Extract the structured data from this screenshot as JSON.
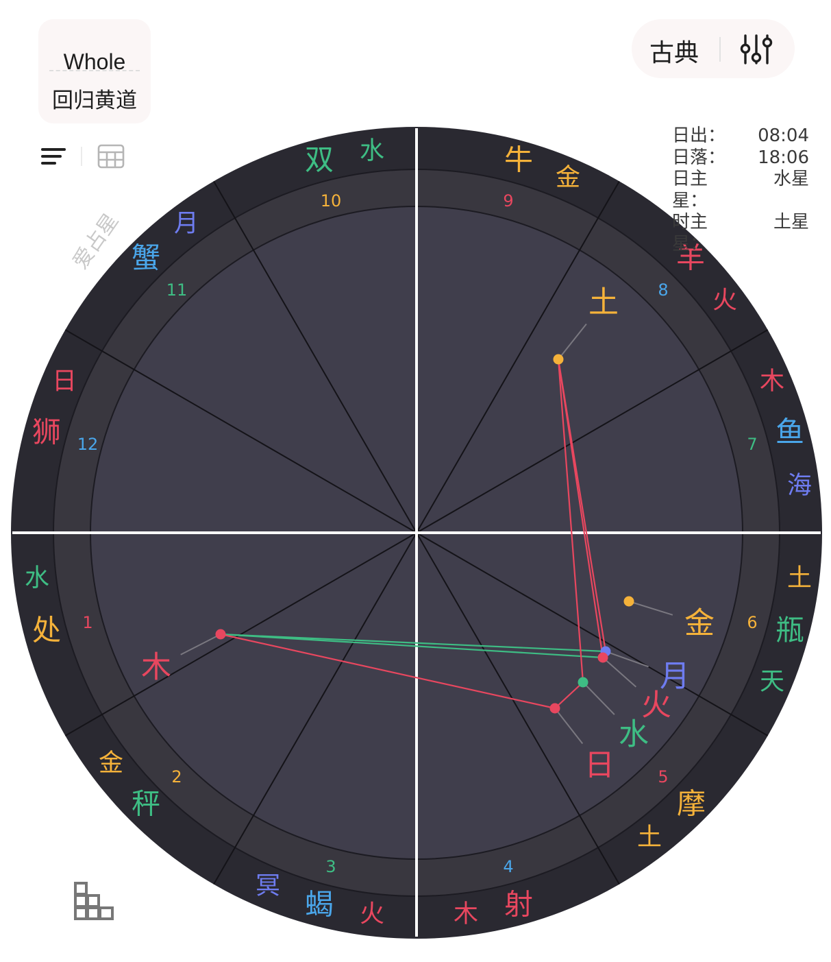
{
  "system_toggle": {
    "house_system": "Whole",
    "zodiac": "回归黄道"
  },
  "mode_toggle": {
    "label": "古典",
    "settings_icon": "sliders-icon"
  },
  "view_toggle": {
    "list_icon": "list-icon",
    "table_icon": "table-icon"
  },
  "bottom_icon": "bar-chart-icon",
  "watermark": "爱占星",
  "info": [
    {
      "key": "日出：",
      "value": "08:04"
    },
    {
      "key": "日落：",
      "value": "18:06"
    },
    {
      "key": "日主星：",
      "value": "水星"
    },
    {
      "key": "时主星：",
      "value": "土星"
    }
  ],
  "colors": {
    "red": "#e8475f",
    "yellow": "#f5b23a",
    "green": "#3ebd84",
    "blue": "#4aa6ea",
    "indigo": "#6e7cf0",
    "outer_ring": "#2a2931",
    "middle_ring": "#39373f",
    "inner_disc": "#403e4c",
    "white_axis": "#ffffff"
  },
  "signs": [
    {
      "name": "双",
      "color": "green"
    },
    {
      "name": "牛",
      "color": "yellow"
    },
    {
      "name": "羊",
      "color": "red"
    },
    {
      "name": "鱼",
      "color": "blue"
    },
    {
      "name": "瓶",
      "color": "green"
    },
    {
      "name": "摩",
      "color": "yellow"
    },
    {
      "name": "射",
      "color": "red"
    },
    {
      "name": "蝎",
      "color": "blue"
    },
    {
      "name": "秤",
      "color": "green"
    },
    {
      "name": "处",
      "color": "yellow"
    },
    {
      "name": "狮",
      "color": "red"
    },
    {
      "name": "蟹",
      "color": "blue"
    }
  ],
  "rulers": [
    {
      "name": "水",
      "color": "green"
    },
    {
      "name": "金",
      "color": "yellow"
    },
    {
      "name": "火",
      "color": "red"
    },
    {
      "name": "木",
      "color": "red"
    },
    {
      "name": "海",
      "color": "indigo"
    },
    {
      "name": "土",
      "color": "yellow"
    },
    {
      "name": "天",
      "color": "green"
    },
    {
      "name": "土",
      "color": "yellow"
    },
    {
      "name": "木",
      "color": "red"
    },
    {
      "name": "冥",
      "color": "indigo"
    },
    {
      "name": "火",
      "color": "red"
    },
    {
      "name": "金",
      "color": "yellow"
    },
    {
      "name": "水",
      "color": "green"
    },
    {
      "name": "日",
      "color": "red"
    },
    {
      "name": "月",
      "color": "indigo"
    }
  ],
  "houses": [
    {
      "number": "10",
      "color": "yellow"
    },
    {
      "number": "9",
      "color": "red"
    },
    {
      "number": "8",
      "color": "blue"
    },
    {
      "number": "7",
      "color": "green"
    },
    {
      "number": "6",
      "color": "yellow"
    },
    {
      "number": "5",
      "color": "red"
    },
    {
      "number": "4",
      "color": "blue"
    },
    {
      "number": "3",
      "color": "green"
    },
    {
      "number": "2",
      "color": "yellow"
    },
    {
      "number": "1",
      "color": "red"
    },
    {
      "number": "12",
      "color": "blue"
    },
    {
      "number": "11",
      "color": "green"
    }
  ],
  "planets": [
    {
      "key": "saturn",
      "name": "土",
      "color": "yellow"
    },
    {
      "key": "venus",
      "name": "金",
      "color": "yellow"
    },
    {
      "key": "moon",
      "name": "月",
      "color": "indigo"
    },
    {
      "key": "mars",
      "name": "火",
      "color": "red"
    },
    {
      "key": "mercury",
      "name": "水",
      "color": "green"
    },
    {
      "key": "sun",
      "name": "日",
      "color": "red"
    },
    {
      "key": "jupiter",
      "name": "木",
      "color": "red"
    }
  ],
  "aspects": [
    {
      "from": "jupiter",
      "to": "moon",
      "color": "green"
    },
    {
      "from": "jupiter",
      "to": "mars",
      "color": "green"
    },
    {
      "from": "jupiter",
      "to": "sun",
      "color": "red"
    },
    {
      "from": "saturn",
      "to": "moon",
      "color": "red"
    },
    {
      "from": "saturn",
      "to": "mars",
      "color": "red"
    },
    {
      "from": "saturn",
      "to": "mercury",
      "color": "red"
    },
    {
      "from": "sun",
      "to": "mercury",
      "color": "red"
    }
  ]
}
